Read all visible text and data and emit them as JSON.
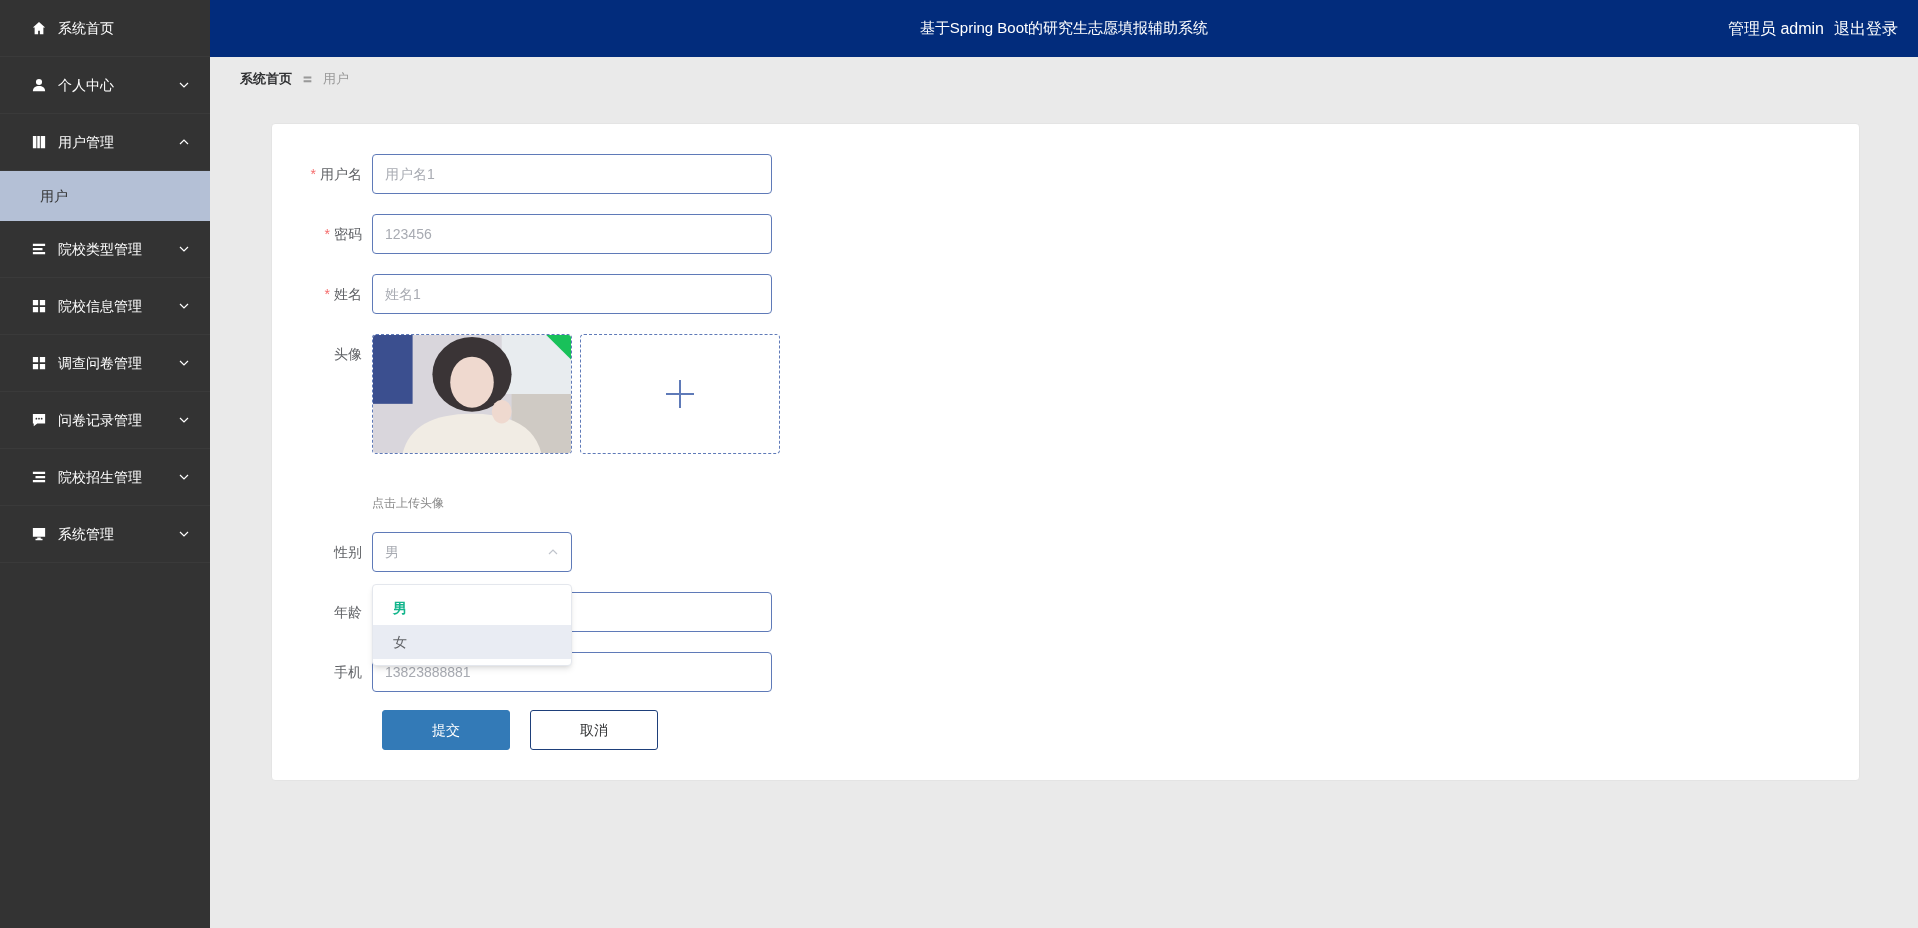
{
  "sidebar": {
    "items": [
      {
        "label": "系统首页"
      },
      {
        "label": "个人中心",
        "expanded": false
      },
      {
        "label": "用户管理",
        "expanded": true,
        "children": [
          {
            "label": "用户",
            "selected": true
          }
        ]
      },
      {
        "label": "院校类型管理",
        "expanded": false
      },
      {
        "label": "院校信息管理",
        "expanded": false
      },
      {
        "label": "调查问卷管理",
        "expanded": false
      },
      {
        "label": "问卷记录管理",
        "expanded": false
      },
      {
        "label": "院校招生管理",
        "expanded": false
      },
      {
        "label": "系统管理",
        "expanded": false
      }
    ]
  },
  "header": {
    "title": "基于Spring Boot的研究生志愿填报辅助系统",
    "user": "管理员 admin",
    "logout": "退出登录"
  },
  "breadcrumb": [
    {
      "label": "系统首页"
    },
    {
      "label": "用户"
    }
  ],
  "breadcrumb_separator": "〓",
  "form": {
    "fields": [
      {
        "kind": "input",
        "label": "用户名",
        "required_mark": "*",
        "placeholder": "用户名1"
      },
      {
        "kind": "input",
        "label": "密码",
        "required_mark": "*",
        "placeholder": "123456"
      },
      {
        "kind": "input",
        "label": "姓名",
        "required_mark": "*",
        "placeholder": "姓名1"
      },
      {
        "kind": "upload",
        "label": "头像",
        "hint": "点击上传头像"
      },
      {
        "kind": "select",
        "label": "性别",
        "value": "男",
        "open": true,
        "options": [
          {
            "label": "男",
            "selected": true,
            "hovered": false
          },
          {
            "label": "女",
            "selected": false,
            "hovered": true
          }
        ]
      },
      {
        "kind": "input",
        "label": "年龄"
      },
      {
        "kind": "input",
        "label": "手机",
        "placeholder": "13823888881"
      }
    ],
    "buttons": [
      {
        "label": "提交",
        "kind": "primary"
      },
      {
        "label": "取消",
        "kind": "secondary"
      }
    ]
  }
}
